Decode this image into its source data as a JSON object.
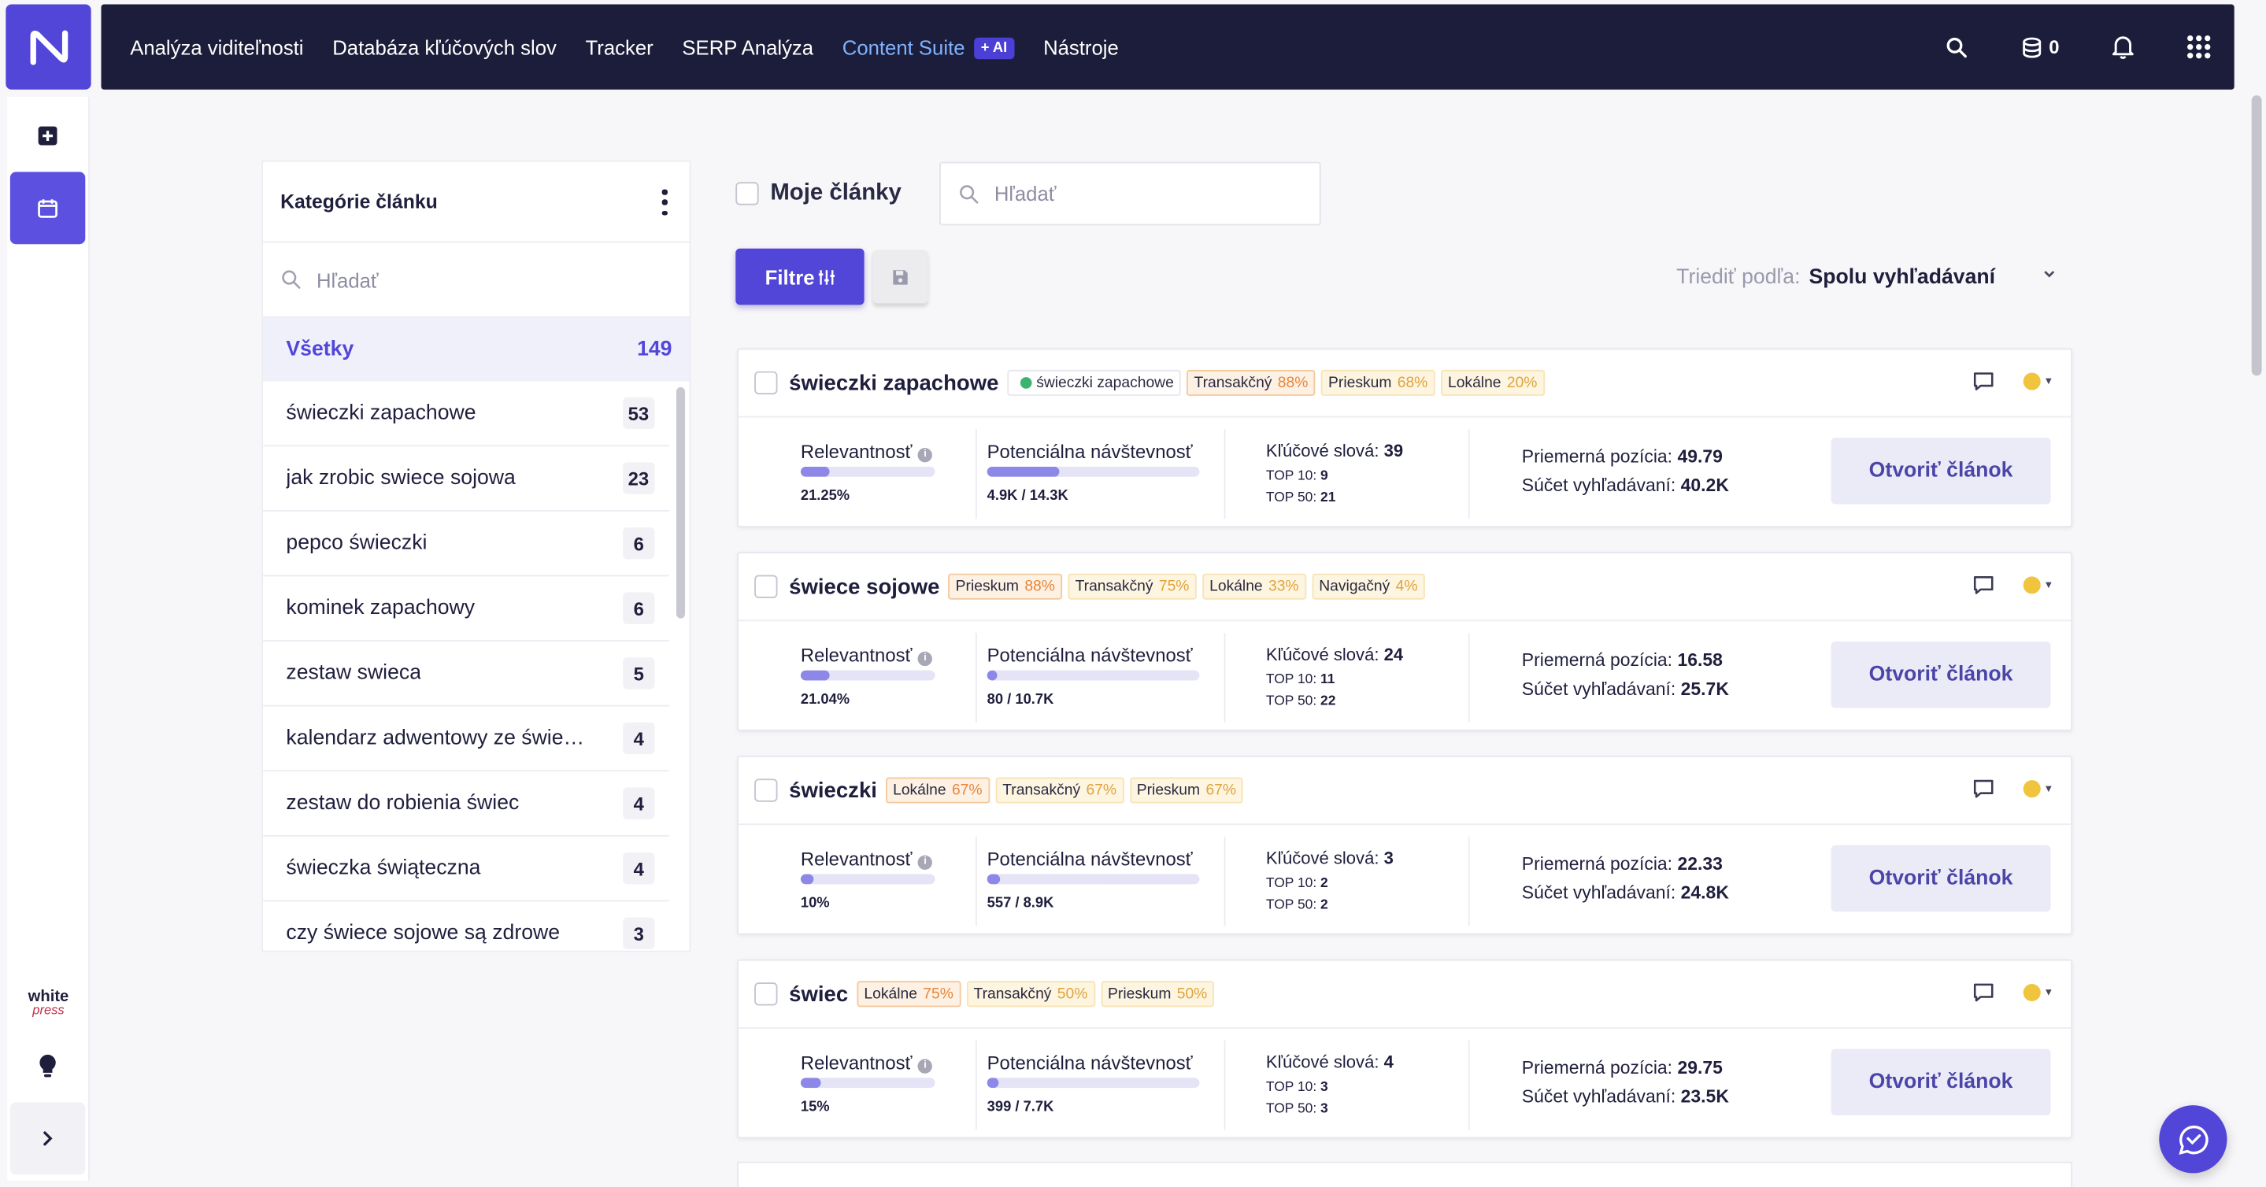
{
  "nav": {
    "items": [
      "Analýza viditeľnosti",
      "Databáza kľúčových slov",
      "Tracker",
      "SERP Analýza"
    ],
    "content_suite": "Content Suite",
    "ai_badge": "+ AI",
    "tools": "Nástroje",
    "credits": "0"
  },
  "sidebar": {
    "brand_line1": "white",
    "brand_line2": "press"
  },
  "categories": {
    "title": "Kategórie článku",
    "search_placeholder": "Hľadať",
    "all_label": "Všetky",
    "all_count": "149",
    "items": [
      {
        "name": "świeczki zapachowe",
        "count": "53"
      },
      {
        "name": "jak zrobic swiece sojowa",
        "count": "23"
      },
      {
        "name": "pepco świeczki",
        "count": "6"
      },
      {
        "name": "kominek zapachowy",
        "count": "6"
      },
      {
        "name": "zestaw swieca",
        "count": "5"
      },
      {
        "name": "kalendarz adwentowy ze świe…",
        "count": "4"
      },
      {
        "name": "zestaw do robienia świec",
        "count": "4"
      },
      {
        "name": "świeczka świąteczna",
        "count": "4"
      },
      {
        "name": "czy świece sojowe są zdrowe",
        "count": "3"
      }
    ]
  },
  "toolbar": {
    "my_articles": "Moje články",
    "search_placeholder": "Hľadať",
    "filter_label": "Filtre",
    "sort_label": "Triediť podľa:",
    "sort_value": "Spolu vyhľadávaní"
  },
  "labels": {
    "relevance": "Relevantnosť",
    "potential": "Potenciálna návštevnosť",
    "keywords": "Kľúčové slová:",
    "top10": "TOP 10:",
    "top50": "TOP 50:",
    "avg_pos": "Priemerná pozícia:",
    "sum_search": "Súčet vyhľadávaní:",
    "open": "Otvoriť článok"
  },
  "cards": [
    {
      "title": "świeczki zapachowe",
      "green_tag": "świeczki zapachowe",
      "tags": [
        {
          "label": "Transakčný",
          "pct": "88%"
        },
        {
          "label": "Prieskum",
          "pct": "68%"
        },
        {
          "label": "Lokálne",
          "pct": "20%"
        }
      ],
      "relevance": "21.25%",
      "relevance_fill": 0.2125,
      "potential": "4.9K / 14.3K",
      "potential_fill": 0.343,
      "keywords": "39",
      "top10": "9",
      "top50": "21",
      "avg_pos": "49.79",
      "sum_search": "40.2K"
    },
    {
      "title": "świece sojowe",
      "green_tag": "",
      "tags": [
        {
          "label": "Prieskum",
          "pct": "88%"
        },
        {
          "label": "Transakčný",
          "pct": "75%"
        },
        {
          "label": "Lokálne",
          "pct": "33%"
        },
        {
          "label": "Navigačný",
          "pct": "4%"
        }
      ],
      "relevance": "21.04%",
      "relevance_fill": 0.2104,
      "potential": "80 / 10.7K",
      "potential_fill": 0.0075,
      "keywords": "24",
      "top10": "11",
      "top50": "22",
      "avg_pos": "16.58",
      "sum_search": "25.7K"
    },
    {
      "title": "świeczki",
      "green_tag": "",
      "tags": [
        {
          "label": "Lokálne",
          "pct": "67%"
        },
        {
          "label": "Transakčný",
          "pct": "67%"
        },
        {
          "label": "Prieskum",
          "pct": "67%"
        }
      ],
      "relevance": "10%",
      "relevance_fill": 0.1,
      "potential": "557 / 8.9K",
      "potential_fill": 0.0626,
      "keywords": "3",
      "top10": "2",
      "top50": "2",
      "avg_pos": "22.33",
      "sum_search": "24.8K"
    },
    {
      "title": "świec",
      "green_tag": "",
      "tags": [
        {
          "label": "Lokálne",
          "pct": "75%"
        },
        {
          "label": "Transakčný",
          "pct": "50%"
        },
        {
          "label": "Prieskum",
          "pct": "50%"
        }
      ],
      "relevance": "15%",
      "relevance_fill": 0.15,
      "potential": "399 / 7.7K",
      "potential_fill": 0.0518,
      "keywords": "4",
      "top10": "3",
      "top50": "3",
      "avg_pos": "29.75",
      "sum_search": "23.5K"
    }
  ]
}
